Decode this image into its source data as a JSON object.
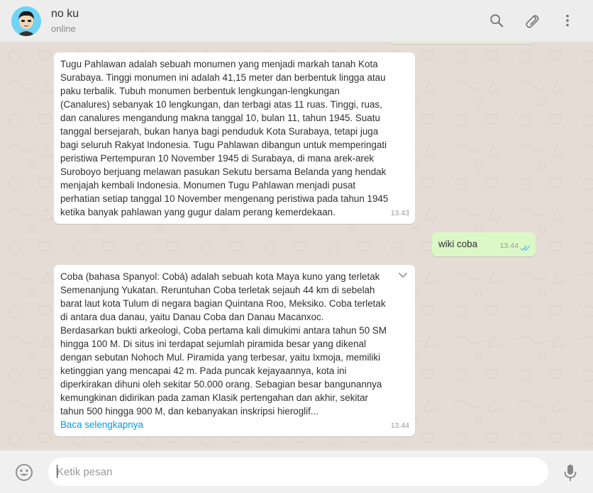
{
  "header": {
    "contact_name": "no ku",
    "status": "online",
    "icons": [
      "search-icon",
      "attach-icon",
      "menu-icon"
    ]
  },
  "messages": [
    {
      "direction": "in",
      "text": "Tugu Pahlawan adalah sebuah monumen yang menjadi markah tanah Kota\nSurabaya. Tinggi monumen ini adalah 41,15 meter dan berbentuk lingga atau\npaku terbalik. Tubuh monumen berbentuk lengkungan-lengkungan\n(Canalures) sebanyak 10 lengkungan, dan terbagi atas 11 ruas. Tinggi, ruas,\ndan canalures mengandung makna tanggal 10, bulan 11, tahun 1945. Suatu\ntanggal bersejarah, bukan hanya bagi penduduk Kota Surabaya, tetapi juga\nbagi seluruh Rakyat Indonesia. Tugu Pahlawan dibangun untuk memperingati\nperistiwa Pertempuran 10 November 1945 di Surabaya, di mana arek-arek\nSuroboyo berjuang melawan pasukan Sekutu bersama Belanda yang hendak\nmenjajah kembali Indonesia. Monumen Tugu Pahlawan menjadi pusat\nperhatian setiap tanggal 10 November mengenang peristiwa pada tahun 1945\nketika banyak pahlawan yang gugur dalam perang kemerdekaan.",
      "time": "13.43"
    },
    {
      "direction": "out",
      "text": "wiki coba",
      "time": "13.44",
      "status_icon": "double-check-read-icon"
    },
    {
      "direction": "in",
      "text": "Coba (bahasa Spanyol: Cobá) adalah sebuah kota Maya kuno yang terletak\nSemenanjung Yukatan. Reruntuhan Coba terletak sejauh 44 km di sebelah\nbarat laut kota Tulum di negara bagian Quintana Roo, Meksiko. Coba terletak\ndi antara dua danau, yaitu Danau Coba dan Danau Macanxoc.\nBerdasarkan bukti arkeologi, Coba pertama kali dimukimi antara tahun 50 SM\nhingga 100 M. Di situs ini terdapat sejumlah piramida besar yang dikenal\ndengan sebutan Nohoch Mul. Piramida yang terbesar, yaitu Ixmoja, memiliki\nketinggian yang mencapai 42 m. Pada puncak kejayaannya, kota ini\ndiperkirakan dihuni oleh sekitar 50.000 orang. Sebagian besar bangunannya\nkemungkinan didirikan pada zaman Klasik pertengahan dan akhir, sekitar\ntahun 500 hingga 900 M, dan kebanyakan inskripsi hieroglif...",
      "read_more": "Baca selengkapnya",
      "time": "13.44"
    }
  ],
  "footer": {
    "input_placeholder": "Ketik pesan",
    "input_value": "",
    "icons": [
      "emoji-icon",
      "microphone-icon"
    ]
  },
  "colors": {
    "header_bg": "#ededed",
    "chat_bg": "#e5ddd5",
    "outgoing_bubble": "#dcf8c6",
    "incoming_bubble": "#ffffff",
    "link": "#039be5",
    "read_tick": "#4fc3f7"
  }
}
